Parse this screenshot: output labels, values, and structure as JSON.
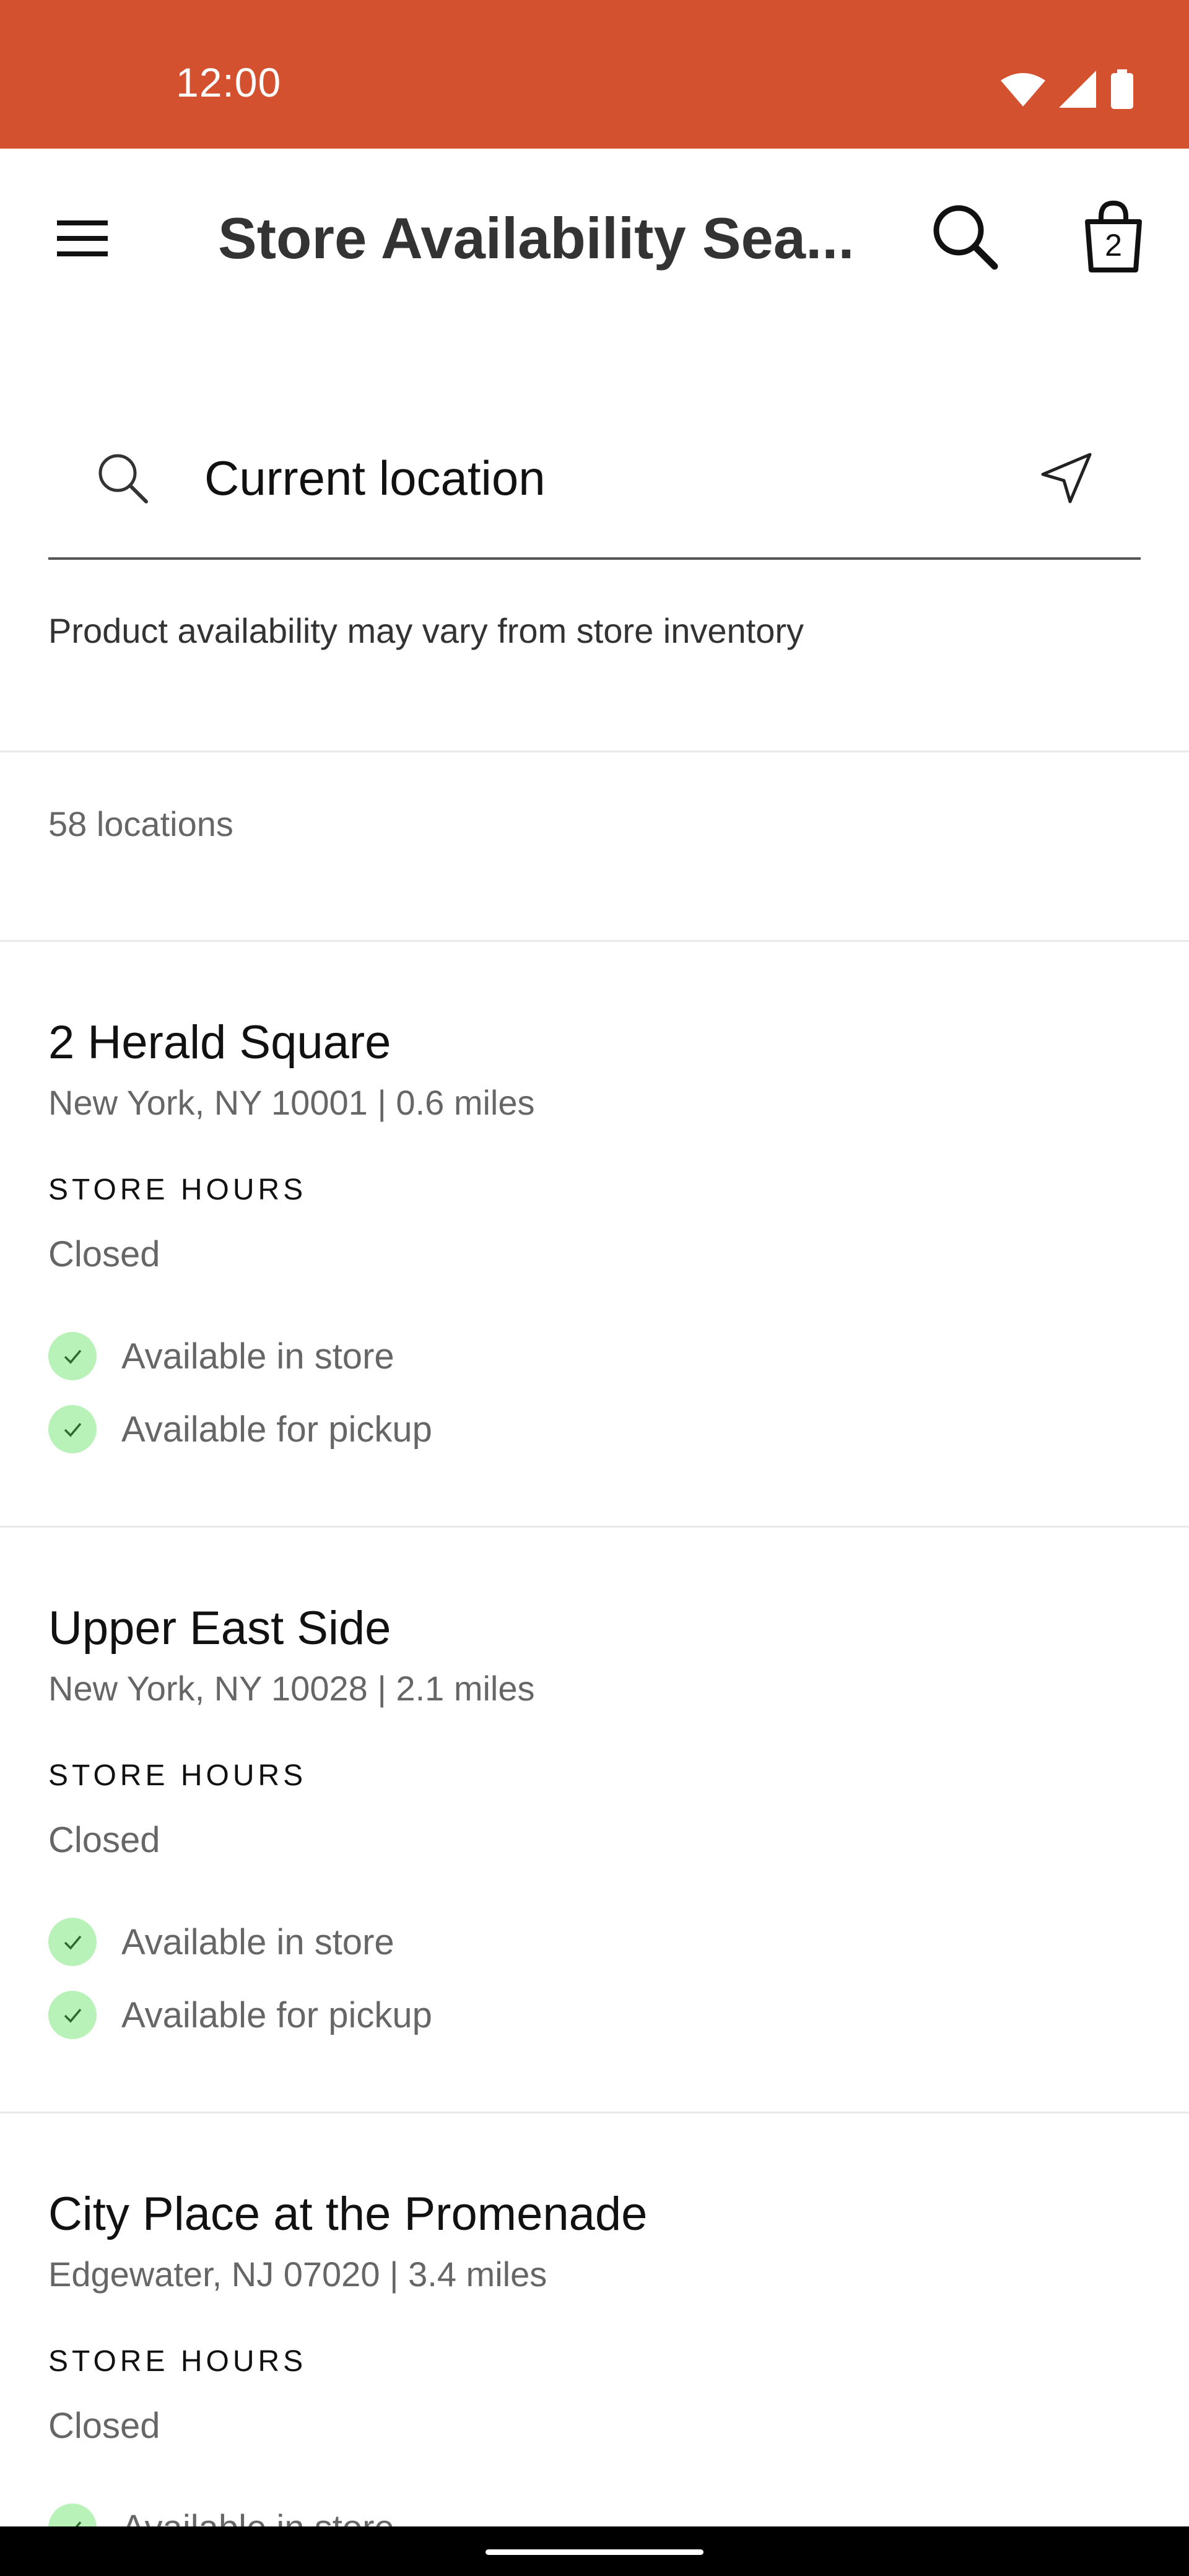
{
  "status_bar": {
    "time": "12:00",
    "background_color": "#d4512f",
    "icons": [
      "wifi-icon",
      "cell-signal-icon",
      "battery-icon"
    ]
  },
  "app_bar": {
    "title": "Store Availability Sea...",
    "menu_icon": "hamburger-menu-icon",
    "search_icon": "search-icon",
    "bag_icon": "shopping-bag-icon",
    "bag_count": "2"
  },
  "search": {
    "value": "Current location",
    "placeholder": "",
    "leading_icon": "search-icon",
    "trailing_icon": "location-arrow-icon"
  },
  "disclaimer": "Product availability may vary from store inventory",
  "results": {
    "count_label": "58 locations"
  },
  "stores": [
    {
      "name": "2 Herald Square",
      "address": "New York, NY 10001 | 0.6 miles",
      "hours_label": "STORE HOURS",
      "hours_value": "Closed",
      "availability": [
        "Available in store",
        "Available for pickup"
      ]
    },
    {
      "name": "Upper East Side",
      "address": "New York, NY 10028 | 2.1 miles",
      "hours_label": "STORE HOURS",
      "hours_value": "Closed",
      "availability": [
        "Available in store",
        "Available for pickup"
      ]
    },
    {
      "name": "City Place at the Promenade",
      "address": "Edgewater, NJ 07020 | 3.4 miles",
      "hours_label": "STORE HOURS",
      "hours_value": "Closed",
      "availability": [
        "Available in store"
      ]
    }
  ],
  "colors": {
    "accent": "#d4512f",
    "check_bg": "#b9f2b9",
    "check_mark": "#2e6b2e"
  }
}
